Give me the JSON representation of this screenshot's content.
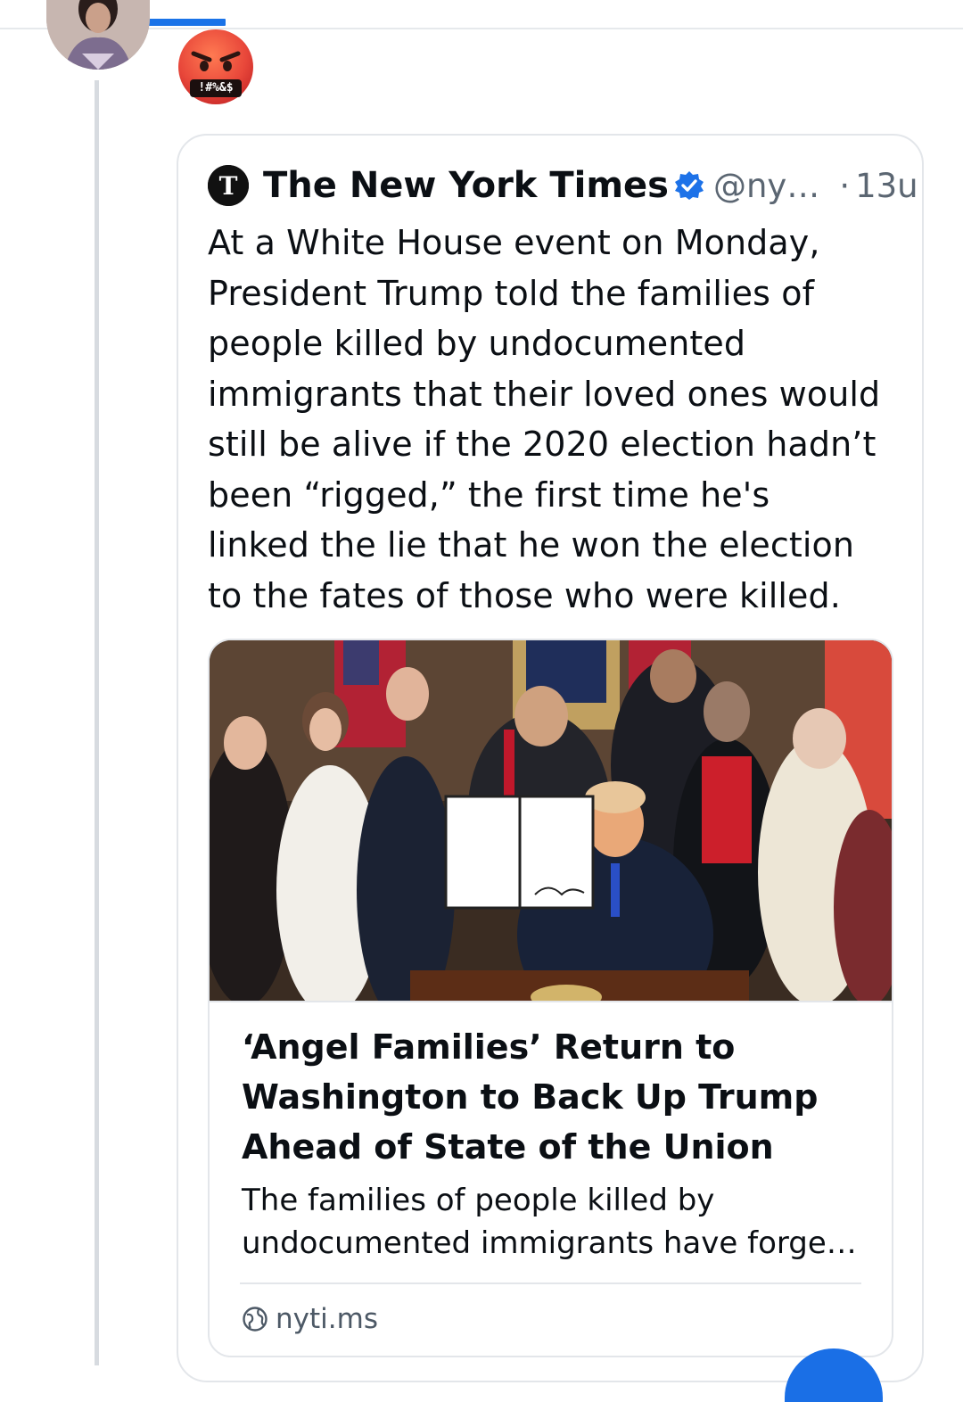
{
  "reaction": {
    "emoji_name": "face-with-symbols-on-mouth",
    "symbols_text": "!#%&$"
  },
  "quoted_post": {
    "author_name": "The New York Times",
    "verified": true,
    "handle": "@ny…",
    "separator": "·",
    "timestamp": "13u",
    "text_lines": [
      "At a White House event on Monday,",
      "President Trump told the families of",
      "people killed by undocumented",
      "immigrants that their loved ones would",
      "still be alive if the 2020 election hadn’t",
      "been “rigged,” the first time he's",
      "linked the lie that he won the election",
      "to the fates of those who were killed."
    ],
    "link_card": {
      "image_alt": "President signing an order surrounded by applauding families",
      "title_lines": [
        "‘Angel Families’ Return to",
        "Washington to Back Up Trump",
        "Ahead of State of the Union"
      ],
      "description_lines": [
        "The families of people killed by",
        "undocumented immigrants have forge…"
      ],
      "domain": "nyti.ms"
    }
  },
  "colors": {
    "accent": "#1a73e8",
    "border": "#e3e6ea",
    "muted_text": "#5b6672",
    "verified_blue": "#1d72e8"
  }
}
